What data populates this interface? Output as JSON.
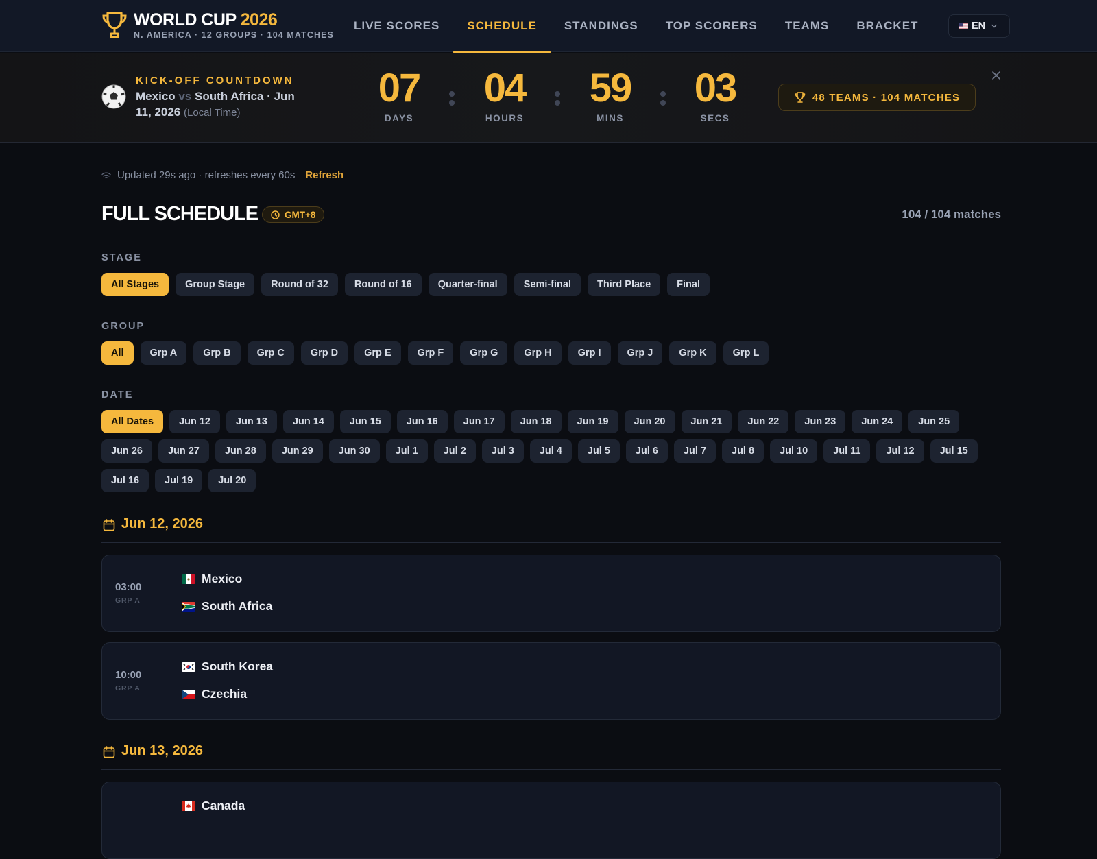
{
  "brand": {
    "title": "WORLD CUP",
    "year": "2026",
    "subtitle": "N. AMERICA · 12 GROUPS · 104 MATCHES"
  },
  "nav": {
    "items": [
      {
        "label": "LIVE SCORES"
      },
      {
        "label": "SCHEDULE",
        "active": true
      },
      {
        "label": "STANDINGS"
      },
      {
        "label": "TOP SCORERS"
      },
      {
        "label": "TEAMS"
      },
      {
        "label": "BRACKET"
      }
    ],
    "language": "EN"
  },
  "countdown": {
    "label": "KICK-OFF COUNTDOWN",
    "home": "Mexico",
    "vs": "vs",
    "away": "South Africa",
    "date": " · Jun 11, 2026",
    "local": "(Local Time)",
    "days": "07",
    "days_label": "DAYS",
    "hours": "04",
    "hours_label": "HOURS",
    "mins": "59",
    "mins_label": "MINS",
    "secs": "03",
    "secs_label": "SECS",
    "badge": "48 TEAMS · 104 MATCHES"
  },
  "status": {
    "updated": "Updated 29s ago · refreshes every 60s",
    "refresh": "Refresh"
  },
  "schedule": {
    "title": "FULL SCHEDULE",
    "timezone": "GMT+8",
    "count": "104 / 104 matches"
  },
  "filters": {
    "stage_label": "STAGE",
    "stages": [
      "All Stages",
      "Group Stage",
      "Round of 32",
      "Round of 16",
      "Quarter-final",
      "Semi-final",
      "Third Place",
      "Final"
    ],
    "group_label": "GROUP",
    "groups": [
      "All",
      "Grp A",
      "Grp B",
      "Grp C",
      "Grp D",
      "Grp E",
      "Grp F",
      "Grp G",
      "Grp H",
      "Grp I",
      "Grp J",
      "Grp K",
      "Grp L"
    ],
    "date_label": "DATE",
    "dates_row1": [
      "All Dates",
      "Jun 12",
      "Jun 13",
      "Jun 14",
      "Jun 15",
      "Jun 16",
      "Jun 17",
      "Jun 18",
      "Jun 19",
      "Jun 20",
      "Jun 21",
      "Jun 22",
      "Jun 23",
      "Jun 24",
      "Jun 25"
    ],
    "dates_row2": [
      "Jun 26",
      "Jun 27",
      "Jun 28",
      "Jun 29",
      "Jun 30",
      "Jul 1",
      "Jul 2",
      "Jul 3",
      "Jul 4",
      "Jul 5",
      "Jul 6",
      "Jul 7",
      "Jul 8",
      "Jul 10",
      "Jul 11",
      "Jul 12",
      "Jul 15"
    ],
    "dates_row3": [
      "Jul 16",
      "Jul 19",
      "Jul 20"
    ]
  },
  "days": [
    {
      "date": "Jun 12, 2026",
      "matches": [
        {
          "time": "03:00",
          "group": "GRP A",
          "home": "Mexico",
          "home_flag": "mx-flag-icon",
          "away": "South Africa",
          "away_flag": "za-flag-icon"
        },
        {
          "time": "10:00",
          "group": "GRP A",
          "home": "South Korea",
          "home_flag": "kr-flag-icon",
          "away": "Czechia",
          "away_flag": "cz-flag-icon"
        }
      ]
    },
    {
      "date": "Jun 13, 2026",
      "matches": [
        {
          "home": "Canada",
          "home_flag": "ca-flag-icon"
        }
      ]
    }
  ],
  "colors": {
    "accent": "#f5b83d",
    "background": "#0b0d12",
    "card": "#121724",
    "chip": "#1d2330"
  }
}
